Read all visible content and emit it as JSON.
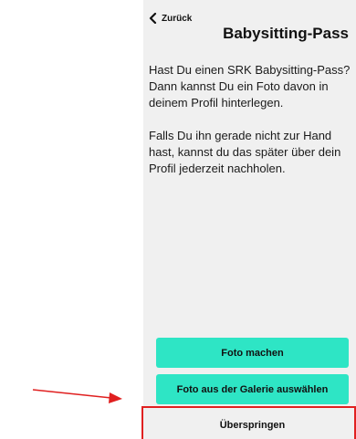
{
  "nav": {
    "back_label": "Zurück",
    "back_icon": "chevron-left-icon"
  },
  "header": {
    "title": "Babysitting-Pass"
  },
  "content": {
    "paragraph_1": "Hast Du einen SRK Babysitting-Pass? Dann kannst Du ein Foto davon in deinem Profil hinterlegen.",
    "paragraph_2": "Falls Du ihn gerade nicht zur Hand hast, kannst du das später über dein Profil jederzeit nachholen."
  },
  "actions": {
    "take_photo_label": "Foto machen",
    "gallery_label": "Foto aus der Galerie auswählen",
    "skip_label": "Überspringen"
  },
  "colors": {
    "screen_background": "#f0f0f0",
    "primary_button": "#2ee5c5",
    "annotation": "#e02020"
  }
}
